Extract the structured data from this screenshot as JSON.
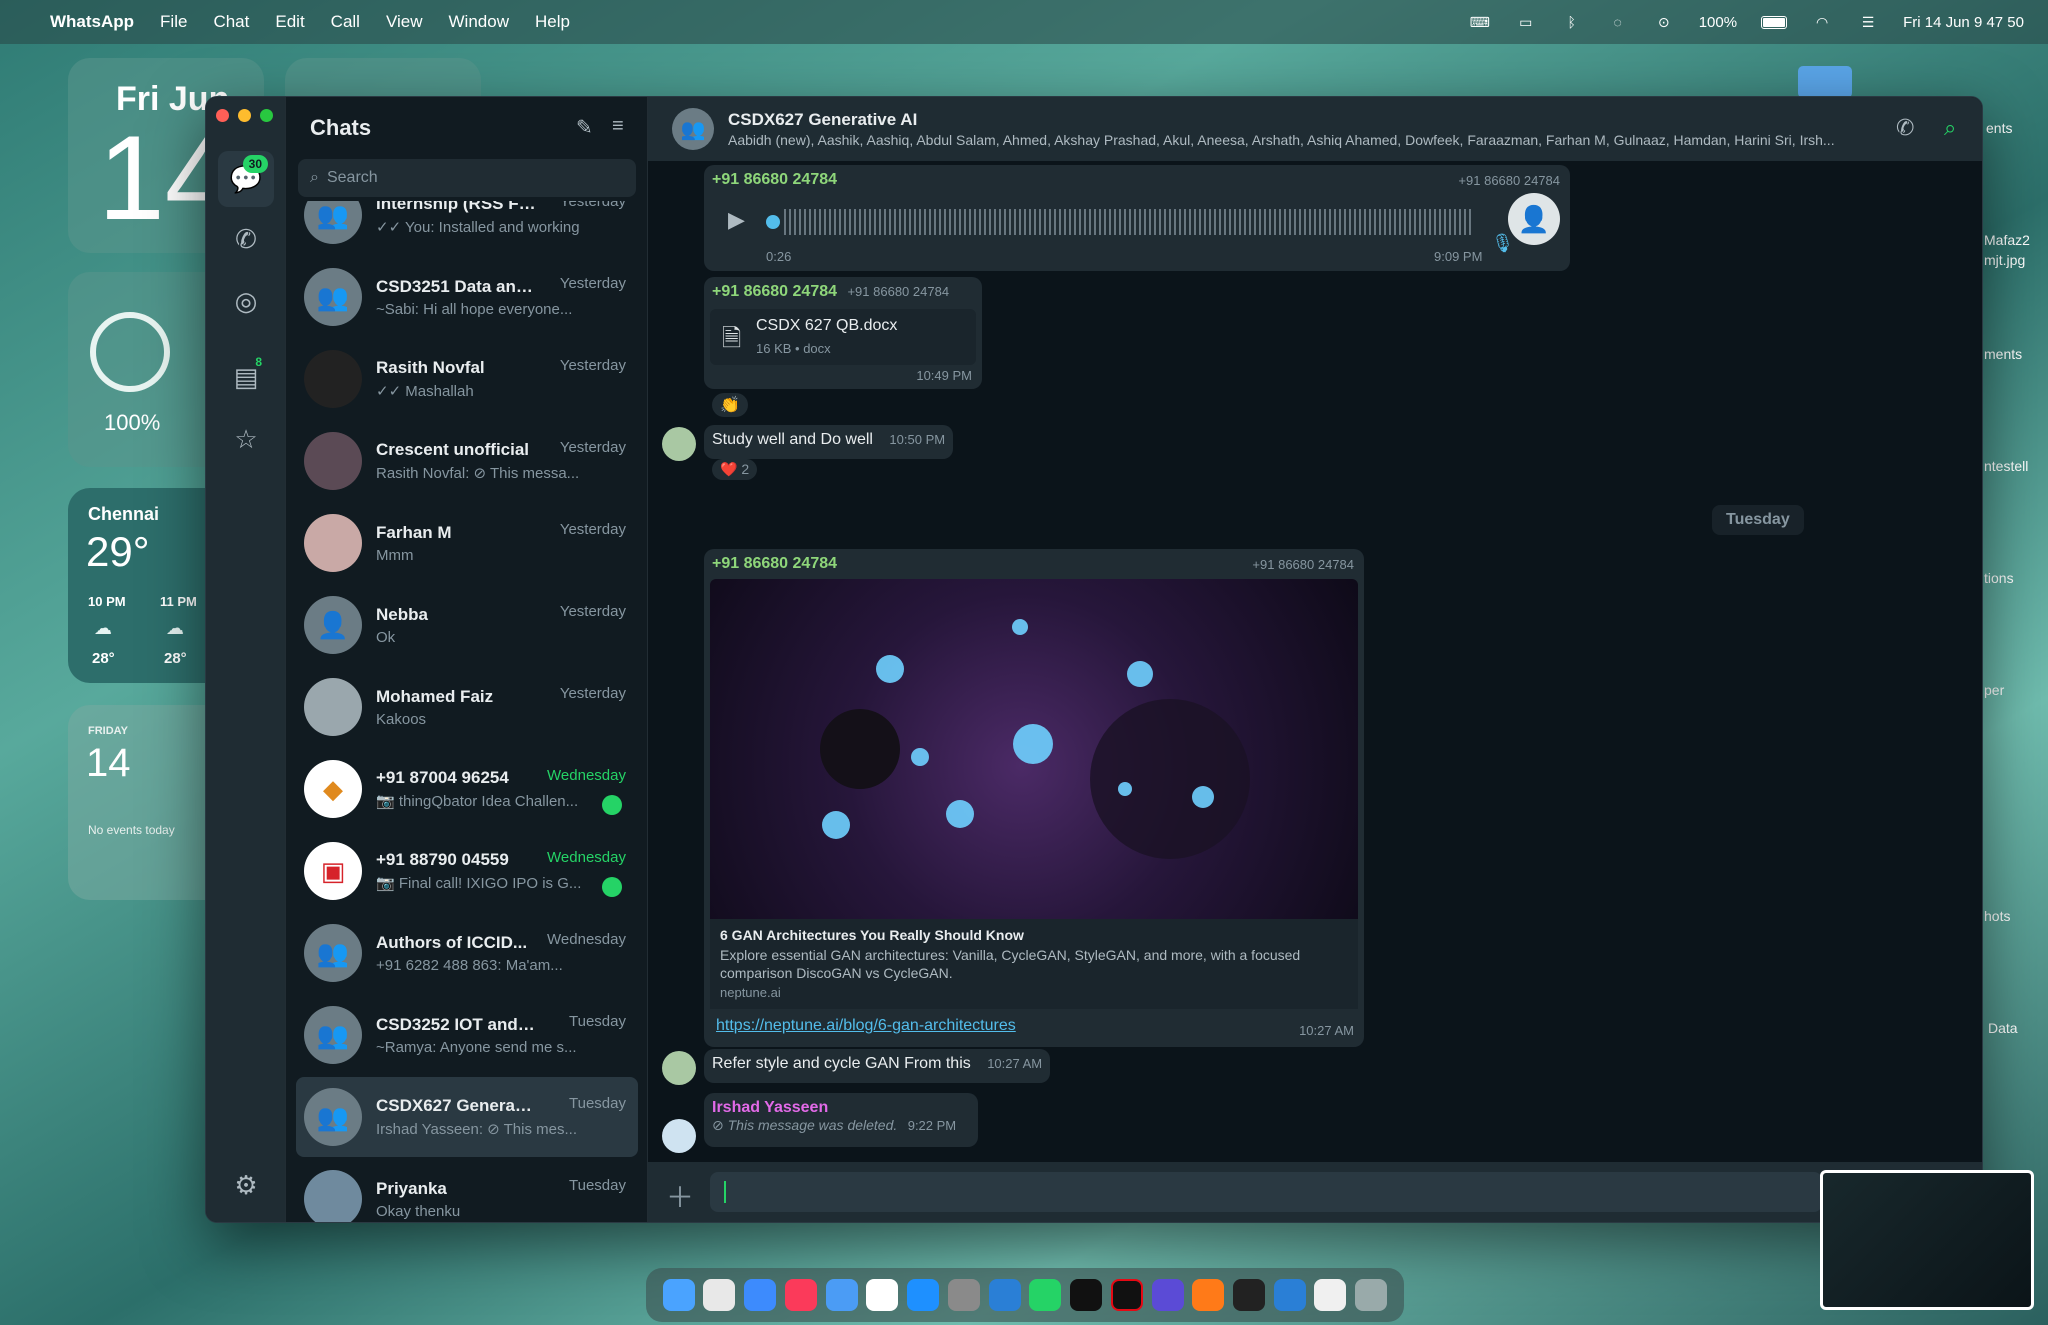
{
  "menubar": {
    "app": "WhatsApp",
    "items": [
      "File",
      "Chat",
      "Edit",
      "Call",
      "View",
      "Window",
      "Help"
    ],
    "battery": "100%",
    "clock": "Fri 14 Jun  9 47 50"
  },
  "desktop": {
    "date_widget": {
      "label": "Fri Jun",
      "day": "14"
    },
    "battery_widget": {
      "percent": "100%"
    },
    "weather_widget": {
      "city": "Chennai",
      "temp": "29°",
      "hours": [
        {
          "time": "10 PM",
          "temp": "28°"
        },
        {
          "time": "11 PM",
          "temp": "28°"
        }
      ]
    },
    "calendar_widget": {
      "weekday": "FRIDAY",
      "day": "14",
      "events": "No events today"
    },
    "side_labels": [
      "ents",
      "Mafaz2",
      "mjt.jpg",
      "ments",
      "ntestell",
      "tions",
      "per",
      "hots",
      "Data"
    ]
  },
  "rail": {
    "chats_badge": "30",
    "channels_badge": "8"
  },
  "chatlist": {
    "title": "Chats",
    "search_placeholder": "Search",
    "rows": [
      {
        "name": "Internship (RSS Fe...",
        "msg": "✓✓ You: Installed and working",
        "time": "Yesterday"
      },
      {
        "name": "CSD3251 Data anal...",
        "msg": "~Sabi: Hi all hope everyone...",
        "time": "Yesterday"
      },
      {
        "name": "Rasith Novfal",
        "msg": "✓✓ Mashallah",
        "time": "Yesterday"
      },
      {
        "name": "Crescent unofficial",
        "msg": "Rasith Novfal: ⊘ This messa...",
        "time": "Yesterday"
      },
      {
        "name": "Farhan M",
        "msg": "Mmm",
        "time": "Yesterday"
      },
      {
        "name": "Nebba",
        "msg": "Ok",
        "time": "Yesterday"
      },
      {
        "name": "Mohamed Faiz",
        "msg": "Kakoos",
        "time": "Yesterday"
      },
      {
        "name": "+91 87004 96254",
        "msg": "📷 thingQbator Idea Challen...",
        "time": "Wednesday",
        "unread": true
      },
      {
        "name": "+91 88790 04559",
        "msg": "📷 Final call! IXIGO IPO is G...",
        "time": "Wednesday",
        "unread": true
      },
      {
        "name": "Authors of ICCID...",
        "msg": "+91 6282 488 863: Ma'am...",
        "time": "Wednesday"
      },
      {
        "name": "CSD3252 IOT and e...",
        "msg": "~Ramya: Anyone send me s...",
        "time": "Tuesday"
      },
      {
        "name": "CSDX627 Generativ...",
        "msg": "Irshad Yasseen: ⊘ This mes...",
        "time": "Tuesday",
        "selected": true
      },
      {
        "name": "Priyanka",
        "msg": "Okay thenku",
        "time": "Tuesday"
      }
    ]
  },
  "conversation": {
    "group_name": "CSDX627 Generative AI",
    "members": "Aabidh (new), Aashik, Aashiq, Abdul Salam, Ahmed, Akshay Prashad, Akul, Aneesa, Arshath, Ashiq Ahamed, Dowfeek, Faraazman, Farhan M, Gulnaaz, Hamdan, Harini Sri, Irsh...",
    "voice_msg": {
      "sender": "+91 86680 24784",
      "phone": "+91 86680 24784",
      "duration": "0:26",
      "time": "9:09 PM"
    },
    "doc_msg": {
      "sender": "+91 86680 24784",
      "phone": "+91 86680 24784",
      "file": "CSDX 627 QB.docx",
      "meta": "16 KB • docx",
      "time": "10:49 PM",
      "reaction": "👏"
    },
    "text_msg1": {
      "text": "Study well and Do well",
      "time": "10:50 PM",
      "reaction": "❤️",
      "reaction_count": "2"
    },
    "day_separator": "Tuesday",
    "link_msg": {
      "sender": "+91 86680 24784",
      "phone": "+91 86680 24784",
      "title": "6 GAN Architectures You Really Should Know",
      "desc": "Explore essential GAN architectures: Vanilla, CycleGAN, StyleGAN, and more, with a focused comparison DiscoGAN vs CycleGAN.",
      "domain": "neptune.ai",
      "url": "https://neptune.ai/blog/6-gan-architectures",
      "time": "10:27 AM"
    },
    "text_msg2": {
      "text": "Refer style and cycle GAN From this",
      "time": "10:27 AM"
    },
    "deleted_msg": {
      "sender": "Irshad Yasseen",
      "text": "⊘ This message was deleted.",
      "time": "9:22 PM"
    }
  }
}
